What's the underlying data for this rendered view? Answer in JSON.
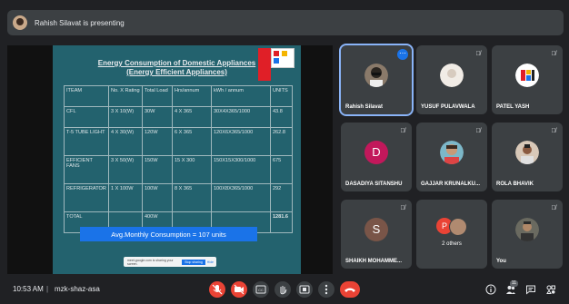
{
  "presenter_bar": {
    "text": "Rahish Silavat is presenting"
  },
  "slide": {
    "title_line1": "Energy Consumption of Domestic Appliances",
    "title_line2": "(Energy Efficient Appliances)",
    "table": {
      "headers": [
        "ITEAM",
        "No. X Rating",
        "Total Load",
        "Hrs/annum",
        "kWh / annum",
        "UNITS"
      ],
      "rows": [
        [
          "CFL",
          "3 X 10(W)",
          "30W",
          "4 X 365",
          "30X4X365/1000",
          "43.8"
        ],
        [
          "T-5 TUBE LIGHT",
          "4 X 30(W)",
          "120W",
          "6 X 365",
          "120X6X365/1000",
          "262.8"
        ],
        [
          "EFFICIENT FANS",
          "3 X 50(W)",
          "150W",
          "15 X 300",
          "150X15X300/1000",
          "675"
        ],
        [
          "REFRIGERATOR",
          "1 X 100W",
          "100W",
          "8 X 365",
          "100X8X365/1000",
          "292"
        ],
        [
          "TOTAL",
          "",
          "400W",
          "",
          "",
          "1281.6"
        ]
      ]
    },
    "avg_text": "Avg.Monthly Consumption = 107 units",
    "share_notice": {
      "message": "meet.google.com is sharing your screen.",
      "stop_label": "Stop sharing",
      "hide_label": "Hide"
    }
  },
  "participants": [
    {
      "name": "Rahish Silavat",
      "type": "photo"
    },
    {
      "name": "YUSUF PULAVWALA",
      "type": "photo"
    },
    {
      "name": "PATEL YASH",
      "type": "photo"
    },
    {
      "name": "DASADIYA SITANSHU",
      "type": "letter",
      "letter": "D",
      "color": "#c2185b"
    },
    {
      "name": "GAJJAR KRUNALKU...",
      "type": "photo"
    },
    {
      "name": "ROLA BHAVIK",
      "type": "photo"
    },
    {
      "name": "SHAIKH MOHAMME...",
      "type": "letter",
      "letter": "S",
      "color": "#795548"
    },
    {
      "name": "2 others",
      "type": "group",
      "letter": "P"
    },
    {
      "name": "You",
      "type": "photo"
    }
  ],
  "bottom_bar": {
    "time": "10:53 AM",
    "separator": "|",
    "meeting_code": "mzk-shaz-asa",
    "people_count": "11"
  },
  "colors": {
    "accent": "#1a73e8",
    "danger": "#ea4335",
    "tile": "#3c4043",
    "background": "#202124"
  }
}
